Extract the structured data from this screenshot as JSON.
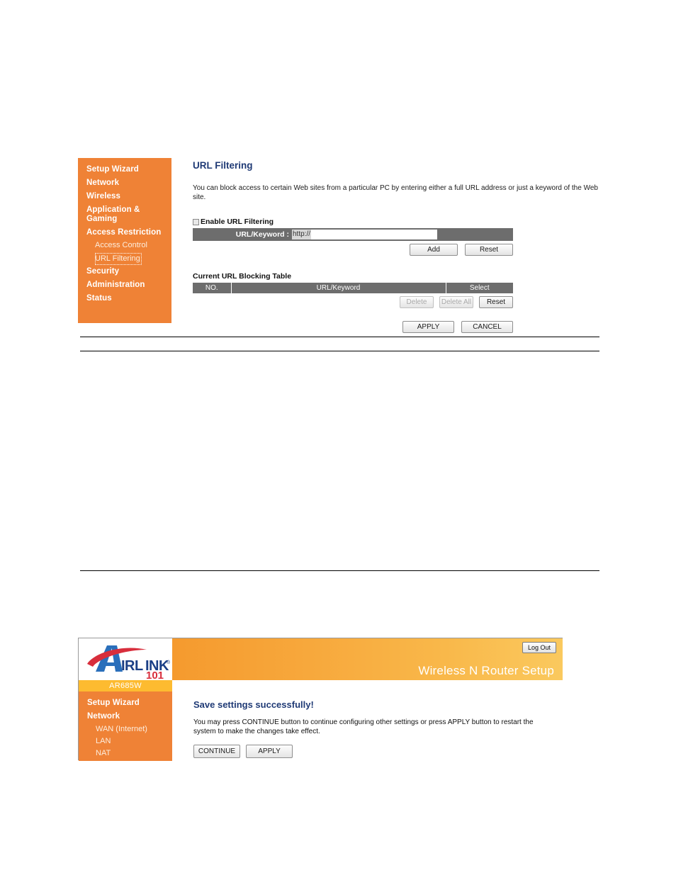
{
  "panel1": {
    "sidebar": {
      "items": [
        {
          "label": "Setup Wizard",
          "level": "top"
        },
        {
          "label": "Network",
          "level": "top"
        },
        {
          "label": "Wireless",
          "level": "top"
        },
        {
          "label": "Application & Gaming",
          "level": "top"
        },
        {
          "label": "Access Restriction",
          "level": "top"
        },
        {
          "label": "Access Control",
          "level": "sub"
        },
        {
          "label": "URL Filtering",
          "level": "sub",
          "selected": true
        },
        {
          "label": "Security",
          "level": "top"
        },
        {
          "label": "Administration",
          "level": "top"
        },
        {
          "label": "Status",
          "level": "top"
        }
      ]
    },
    "title": "URL Filtering",
    "description": "You can block access to certain Web sites from a particular PC by entering either a full URL address or just a keyword of the Web site.",
    "enable_checkbox_label": "Enable URL Filtering",
    "enable_checkbox_checked": false,
    "form": {
      "url_label": "URL/Keyword :",
      "url_prefix": "http://",
      "url_value": "",
      "url_placeholder": "",
      "add_label": "Add",
      "reset_label": "Reset"
    },
    "table": {
      "caption": "Current URL Blocking Table",
      "columns": [
        "NO.",
        "URL/Keyword",
        "Select"
      ],
      "rows": [],
      "delete_label": "Delete",
      "delete_all_label": "Delete All",
      "reset_label": "Reset"
    },
    "footer": {
      "apply_label": "APPLY",
      "cancel_label": "CANCEL"
    }
  },
  "panel2": {
    "logo": {
      "brand": "AIRLINK",
      "suffix": "101",
      "trademark": "®"
    },
    "model": "AR685W",
    "header": {
      "logout_label": "Log Out",
      "title": "Wireless N Router Setup"
    },
    "sidebar": {
      "items": [
        {
          "label": "Setup Wizard",
          "level": "top"
        },
        {
          "label": "Network",
          "level": "top"
        },
        {
          "label": "WAN (Internet)",
          "level": "sub"
        },
        {
          "label": "LAN",
          "level": "sub"
        },
        {
          "label": "NAT",
          "level": "sub"
        }
      ]
    },
    "main": {
      "title": "Save settings successfully!",
      "description": "You may press CONTINUE button to continue configuring other settings or press APPLY button to restart the system to make the changes take effect.",
      "continue_label": "CONTINUE",
      "apply_label": "APPLY"
    }
  },
  "colors": {
    "sidebar_orange": "#ef8236",
    "model_yellow": "#fdbb30",
    "header_gray": "#6d6d6d",
    "title_blue": "#1f3a75"
  }
}
